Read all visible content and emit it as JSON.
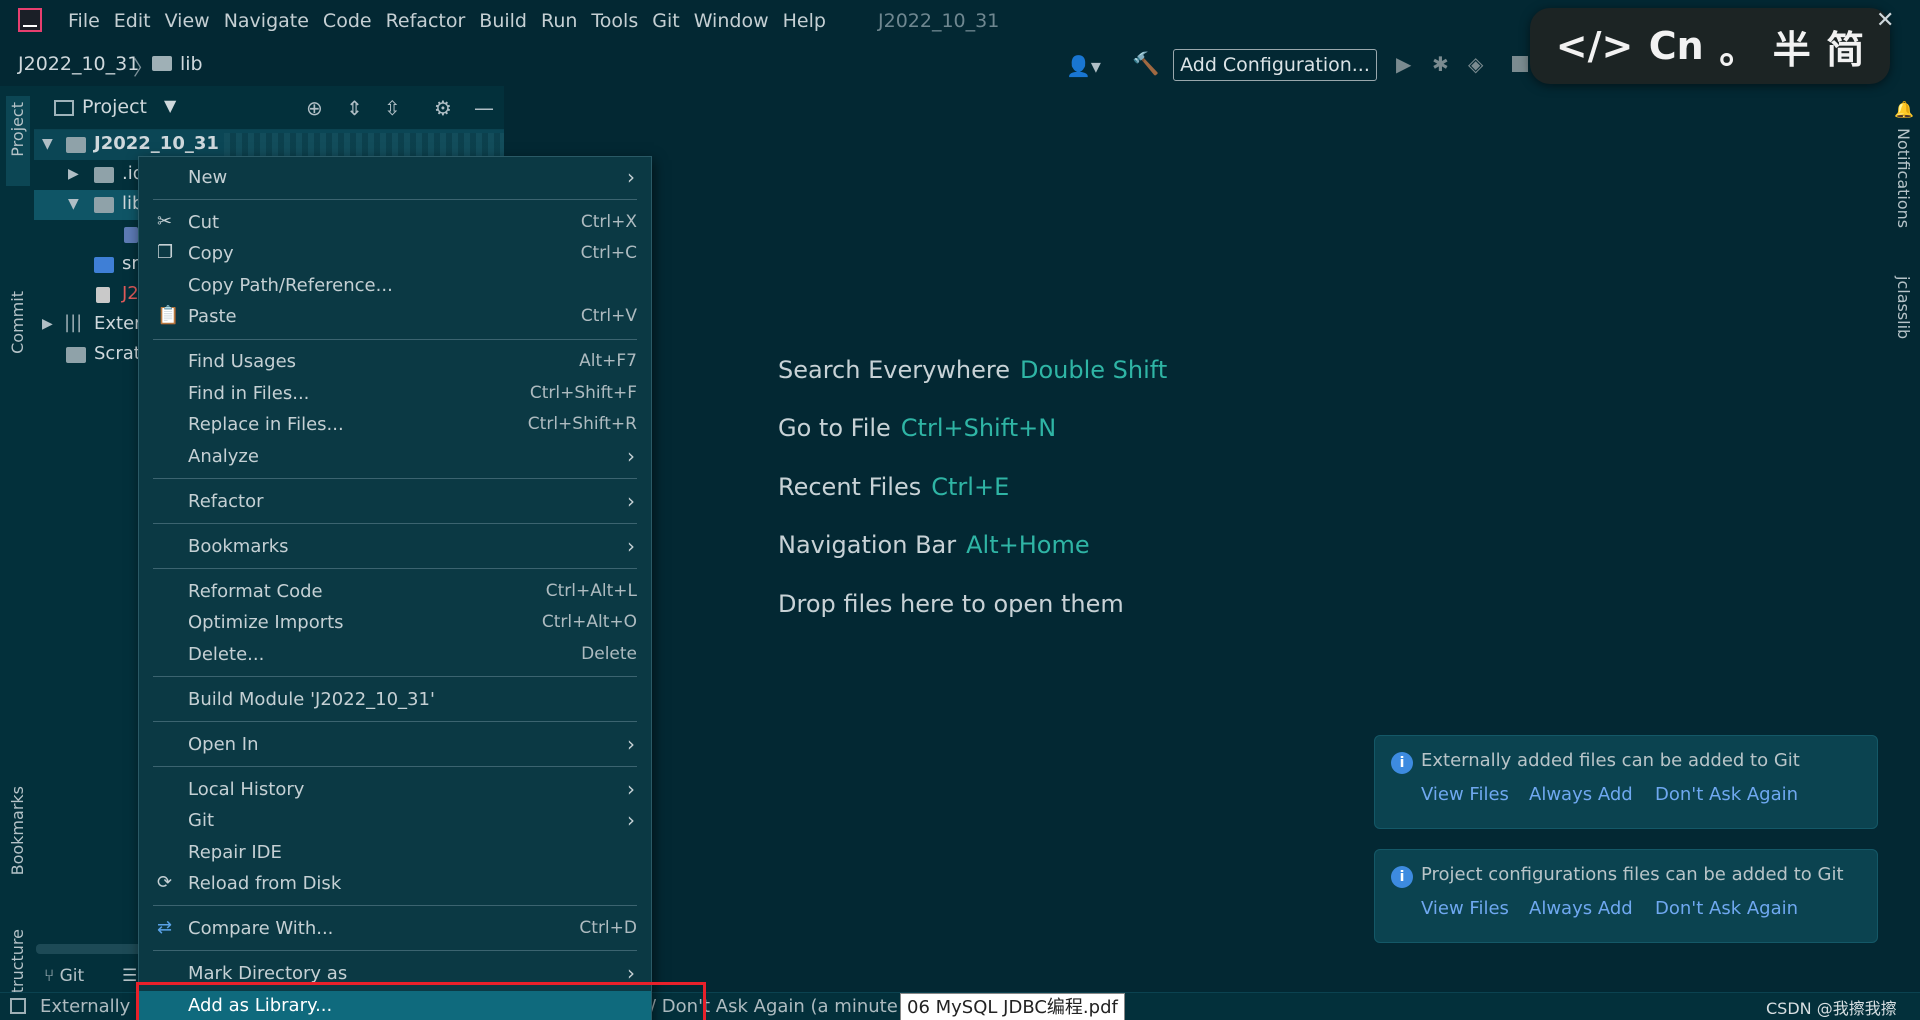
{
  "menubar": {
    "items": [
      "File",
      "Edit",
      "View",
      "Navigate",
      "Code",
      "Refactor",
      "Build",
      "Run",
      "Tools",
      "Git",
      "Window",
      "Help"
    ],
    "window_title": "J2022_10_31"
  },
  "navbar": {
    "project": "J2022_10_31",
    "folder": "lib",
    "add_configuration": "Add Configuration..."
  },
  "ime": {
    "code": "</>",
    "lang": "Cn",
    "punct": "。",
    "width": "半",
    "script": "简"
  },
  "left_strip": {
    "project": "Project",
    "commit": "Commit",
    "bookmarks": "Bookmarks",
    "structure": "Structure"
  },
  "right_strip": {
    "notifications": "Notifications",
    "jclasslib": "jclasslib"
  },
  "project_panel": {
    "title": "Project",
    "tree": [
      {
        "label": "J2022_10_31",
        "color": "#cfd8dc"
      },
      {
        "label": ".id",
        "color": "#cfd8dc"
      },
      {
        "label": "lib",
        "color": "#cfd8dc"
      },
      {
        "label": "",
        "color": "#cfd8dc"
      },
      {
        "label": "sr",
        "color": "#cfd8dc"
      },
      {
        "label": "J2",
        "color": "#e05a5a"
      },
      {
        "label": "Exter",
        "color": "#cfd8dc"
      },
      {
        "label": "Scrat",
        "color": "#cfd8dc"
      }
    ],
    "git_tab": "Git"
  },
  "context_menu": {
    "new": "New",
    "cut": "Cut",
    "cut_key": "Ctrl+X",
    "copy": "Copy",
    "copy_key": "Ctrl+C",
    "copy_path": "Copy Path/Reference...",
    "paste": "Paste",
    "paste_key": "Ctrl+V",
    "find_usages": "Find Usages",
    "find_usages_key": "Alt+F7",
    "find_in_files": "Find in Files...",
    "find_in_files_key": "Ctrl+Shift+F",
    "replace_in_files": "Replace in Files...",
    "replace_in_files_key": "Ctrl+Shift+R",
    "analyze": "Analyze",
    "refactor": "Refactor",
    "bookmarks": "Bookmarks",
    "reformat": "Reformat Code",
    "reformat_key": "Ctrl+Alt+L",
    "optimize": "Optimize Imports",
    "optimize_key": "Ctrl+Alt+O",
    "delete": "Delete...",
    "delete_key": "Delete",
    "build_module": "Build Module 'J2022_10_31'",
    "open_in": "Open In",
    "local_history": "Local History",
    "git": "Git",
    "repair_ide": "Repair IDE",
    "reload": "Reload from Disk",
    "compare": "Compare With...",
    "compare_key": "Ctrl+D",
    "mark_dir": "Mark Directory as",
    "add_library": "Add as Library..."
  },
  "hints": [
    {
      "text": "Search Everywhere",
      "key": "Double Shift"
    },
    {
      "text": "Go to File",
      "key": "Ctrl+Shift+N"
    },
    {
      "text": "Recent Files",
      "key": "Ctrl+E"
    },
    {
      "text": "Navigation Bar",
      "key": "Alt+Home"
    },
    {
      "text": "Drop files here to open them",
      "key": ""
    }
  ],
  "notifications": [
    {
      "message": "Externally added files can be added to Git",
      "actions": [
        "View Files",
        "Always Add",
        "Don't Ask Again"
      ]
    },
    {
      "message": "Project configurations files can be added to Git",
      "actions": [
        "View Files",
        "Always Add",
        "Don't Ask Again"
      ]
    }
  ],
  "statusbar": {
    "left": "Externally a",
    "mid": "/ Don't Ask Again (a minute",
    "tooltip": "06 MySQL JDBC编程.pdf",
    "watermark": "CSDN @我擦我擦"
  },
  "colors": {
    "background": "#032833",
    "accent": "#2fb5a5",
    "link": "#6fa8f0",
    "selection": "#0f6a7d",
    "highlight": "#e8212b"
  }
}
